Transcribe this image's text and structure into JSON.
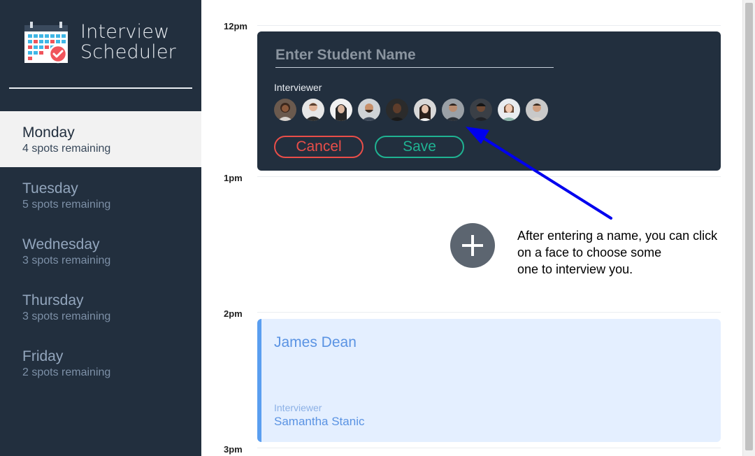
{
  "sidebar": {
    "app_title_line1": "Interview",
    "app_title_line2": "Scheduler",
    "logo_icon": "calendar-check-icon",
    "days": [
      {
        "name": "Monday",
        "spots": "4 spots remaining",
        "selected": true
      },
      {
        "name": "Tuesday",
        "spots": "5 spots remaining",
        "selected": false
      },
      {
        "name": "Wednesday",
        "spots": "3 spots remaining",
        "selected": false
      },
      {
        "name": "Thursday",
        "spots": "3 spots remaining",
        "selected": false
      },
      {
        "name": "Friday",
        "spots": "2 spots remaining",
        "selected": false
      }
    ]
  },
  "schedule": {
    "times": [
      "12pm",
      "1pm",
      "2pm",
      "3pm"
    ]
  },
  "form": {
    "student_name_placeholder": "Enter Student Name",
    "student_name_value": "",
    "interviewer_label": "Interviewer",
    "avatar_count": 10,
    "cancel_label": "Cancel",
    "save_label": "Save"
  },
  "empty_slot": {
    "add_icon": "plus-icon"
  },
  "annotation": {
    "line1": "After entering a name, you can click",
    "line2": "on a face to choose some",
    "line3": "one to interview you.",
    "arrow_color": "#0000ee"
  },
  "appointment": {
    "student": "James Dean",
    "interviewer_label": "Interviewer",
    "interviewer": "Samantha Stanic"
  },
  "colors": {
    "sidebar_bg": "#222f3e",
    "cancel": "#ea4e49",
    "save": "#1fb392",
    "appointment_accent": "#5a9ef0"
  }
}
